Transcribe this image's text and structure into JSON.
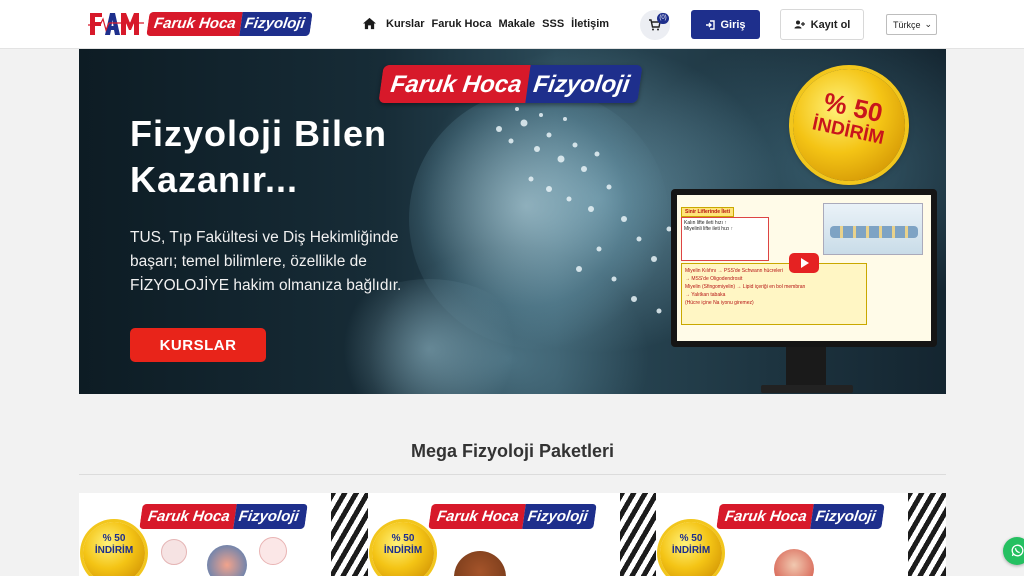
{
  "header": {
    "brand": {
      "part1": "Faruk Hoca",
      "part2": "Fizyoloji"
    },
    "nav": [
      {
        "label": "Kurslar"
      },
      {
        "label": "Faruk Hoca"
      },
      {
        "label": "Makale"
      },
      {
        "label": "SSS"
      },
      {
        "label": "İletişim"
      }
    ],
    "cart_count": "(0)",
    "login_label": "Giriş",
    "register_label": "Kayıt ol",
    "language": "Türkçe"
  },
  "hero": {
    "brand": {
      "part1": "Faruk Hoca",
      "part2": "Fizyoloji"
    },
    "title_line1": "Fizyoloji Bilen",
    "title_line2": "Kazanır...",
    "text_line1": "TUS, Tıp Fakültesi ve Diş Hekimliğinde",
    "text_line2": "başarı; temel bilimlere, özellikle de",
    "text_line3": "FİZYOLOJİYE hakim olmanıza bağlıdır.",
    "cta_label": "KURSLAR",
    "discount_line1": "% 50",
    "discount_line2": "İNDİRİM",
    "screen": {
      "heading": "Sinir Liflerinde İleti",
      "bullet1": "Kalın lifte ileti hızı ↑",
      "bullet2": "Miyelinli lifte ileti hızı ↑",
      "line1": "Miyelin Kılıfını → PSS'de Schwann hücreleri",
      "line2": "→ MSS'de Oligodendrosit",
      "line3": "Miyelin (Sfingomiyelin) → Lipid içeriği en bol membran",
      "line4": "→ Yalıtkan tabaka",
      "line5": "(Hücre içine Na iyonu giremez)"
    }
  },
  "section": {
    "title": "Mega Fizyoloji Paketleri"
  },
  "cards": [
    {
      "brand1": "Faruk Hoca",
      "brand2": "Fizyoloji",
      "badge1": "% 50",
      "badge2": "İNDİRİM"
    },
    {
      "brand1": "Faruk Hoca",
      "brand2": "Fizyoloji",
      "badge1": "% 50",
      "badge2": "İNDİRİM"
    },
    {
      "brand1": "Faruk Hoca",
      "brand2": "Fizyoloji",
      "badge1": "% 50",
      "badge2": "İNDİRİM"
    }
  ],
  "colors": {
    "brand_red": "#d7192a",
    "brand_blue": "#1e2f8c",
    "cta_red": "#e8241a",
    "whatsapp_green": "#25c061"
  },
  "icons": [
    "logo-icon",
    "home-icon",
    "cart-icon",
    "login-icon",
    "user-plus-icon",
    "chevron-down-icon",
    "play-icon",
    "whatsapp-icon"
  ]
}
